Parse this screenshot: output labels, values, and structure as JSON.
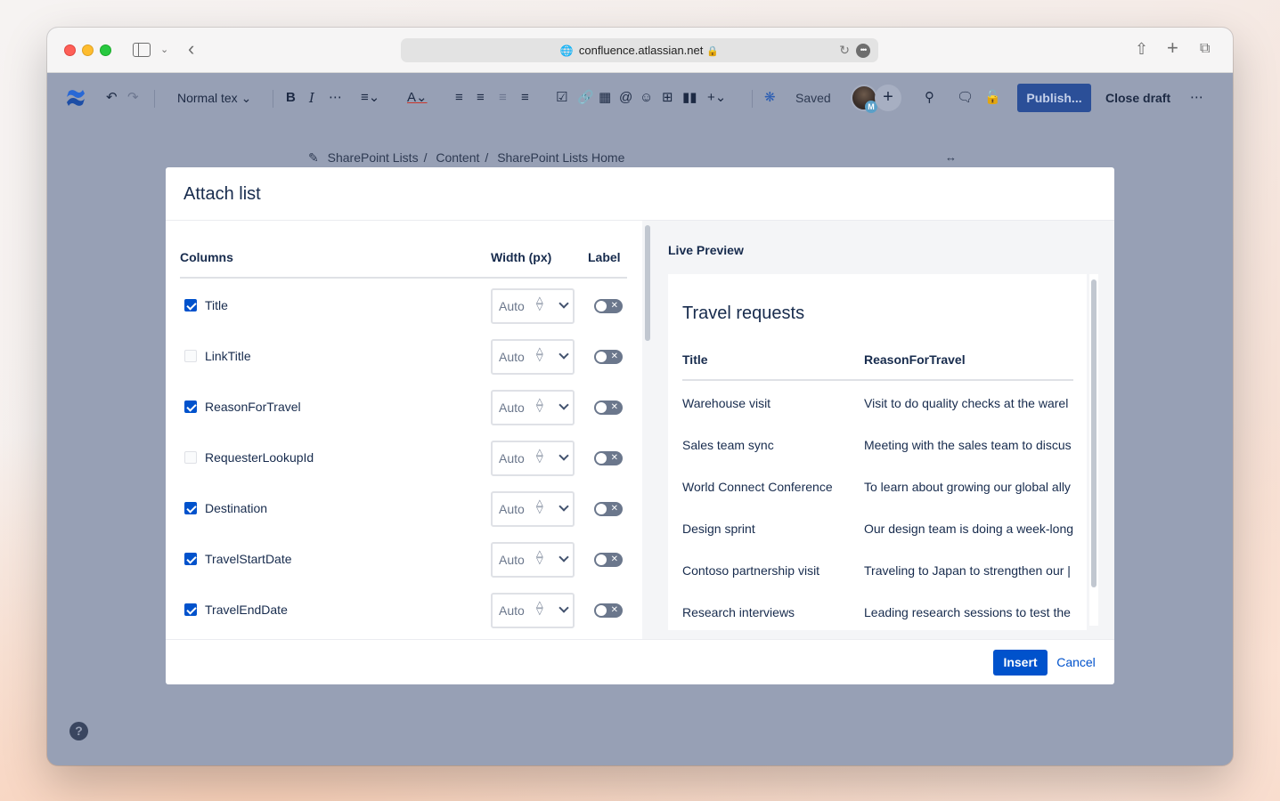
{
  "browser": {
    "url": "confluence.atlassian.net"
  },
  "toolbar": {
    "text_style": "Normal tex",
    "saved_label": "Saved",
    "avatar_badge": "M",
    "publish_label": "Publish...",
    "close_draft_label": "Close draft"
  },
  "breadcrumb": {
    "items": [
      "SharePoint Lists",
      "Content",
      "SharePoint Lists Home"
    ]
  },
  "modal": {
    "title": "Attach list",
    "columns_header": "Columns",
    "width_header": "Width (px)",
    "label_header": "Label",
    "rows": [
      {
        "name": "Title",
        "checked": true,
        "width": "Auto"
      },
      {
        "name": "LinkTitle",
        "checked": false,
        "width": "Auto"
      },
      {
        "name": "ReasonForTravel",
        "checked": true,
        "width": "Auto"
      },
      {
        "name": "RequesterLookupId",
        "checked": false,
        "width": "Auto"
      },
      {
        "name": "Destination",
        "checked": true,
        "width": "Auto"
      },
      {
        "name": "TravelStartDate",
        "checked": true,
        "width": "Auto"
      },
      {
        "name": "TravelEndDate",
        "checked": true,
        "width": "Auto"
      }
    ],
    "preview": {
      "label": "Live Preview",
      "title": "Travel requests",
      "headers": [
        "Title",
        "ReasonForTravel"
      ],
      "rows": [
        [
          "Warehouse visit",
          "Visit to do quality checks at the warel"
        ],
        [
          "Sales team sync",
          "Meeting with the sales team to discus"
        ],
        [
          "World Connect Conference",
          "To learn about growing our global ally"
        ],
        [
          "Design sprint",
          "Our design team is doing a week-long"
        ],
        [
          "Contoso partnership visit",
          "Traveling to Japan to strengthen our |"
        ],
        [
          "Research interviews",
          "Leading research sessions to test the"
        ]
      ]
    },
    "insert_label": "Insert",
    "cancel_label": "Cancel"
  }
}
